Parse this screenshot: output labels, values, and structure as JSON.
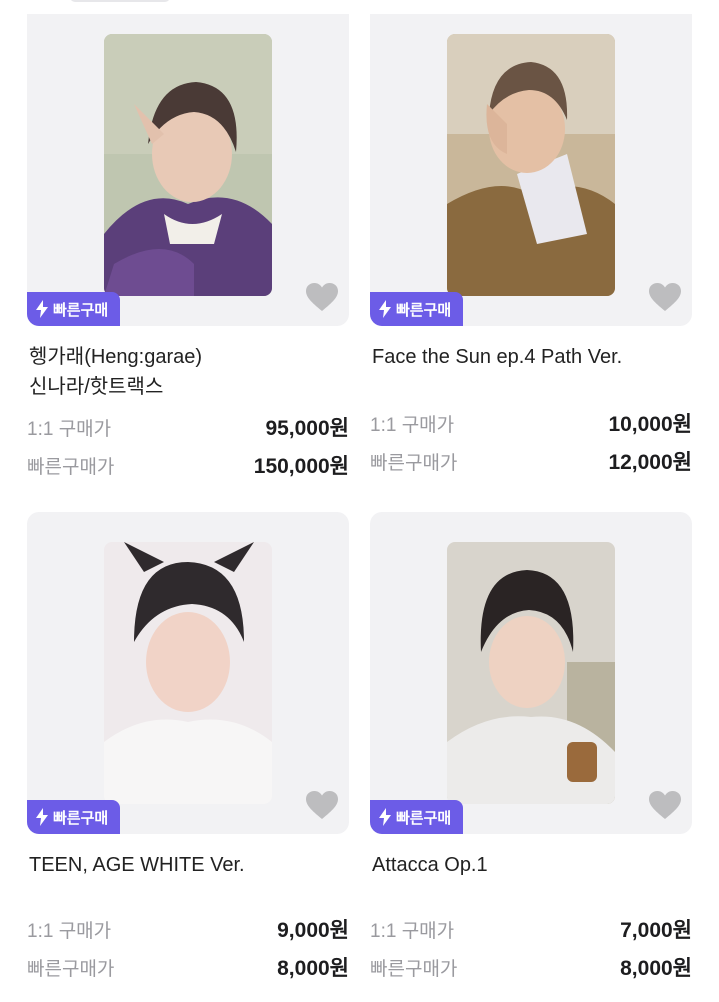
{
  "badge_label": "빠른구매",
  "labels": {
    "one_to_one": "1:1 구매가",
    "quick": "빠른구매가"
  },
  "colors": {
    "accent": "#6c5ce7",
    "heart": "#bdbdbf",
    "card_bg": "#f2f2f4"
  },
  "products": [
    {
      "title_line1": "헹가래(Heng:garae)",
      "title_line2": "신나라/핫트랙스",
      "price_1to1": "95,000원",
      "price_quick": "150,000원"
    },
    {
      "title_line1": "Face the Sun ep.4 Path Ver.",
      "title_line2": "",
      "price_1to1": "10,000원",
      "price_quick": "12,000원"
    },
    {
      "title_line1": "TEEN, AGE WHITE Ver.",
      "title_line2": "",
      "price_1to1": "9,000원",
      "price_quick": "8,000원"
    },
    {
      "title_line1": "Attacca Op.1",
      "title_line2": "",
      "price_1to1": "7,000원",
      "price_quick": "8,000원"
    }
  ]
}
